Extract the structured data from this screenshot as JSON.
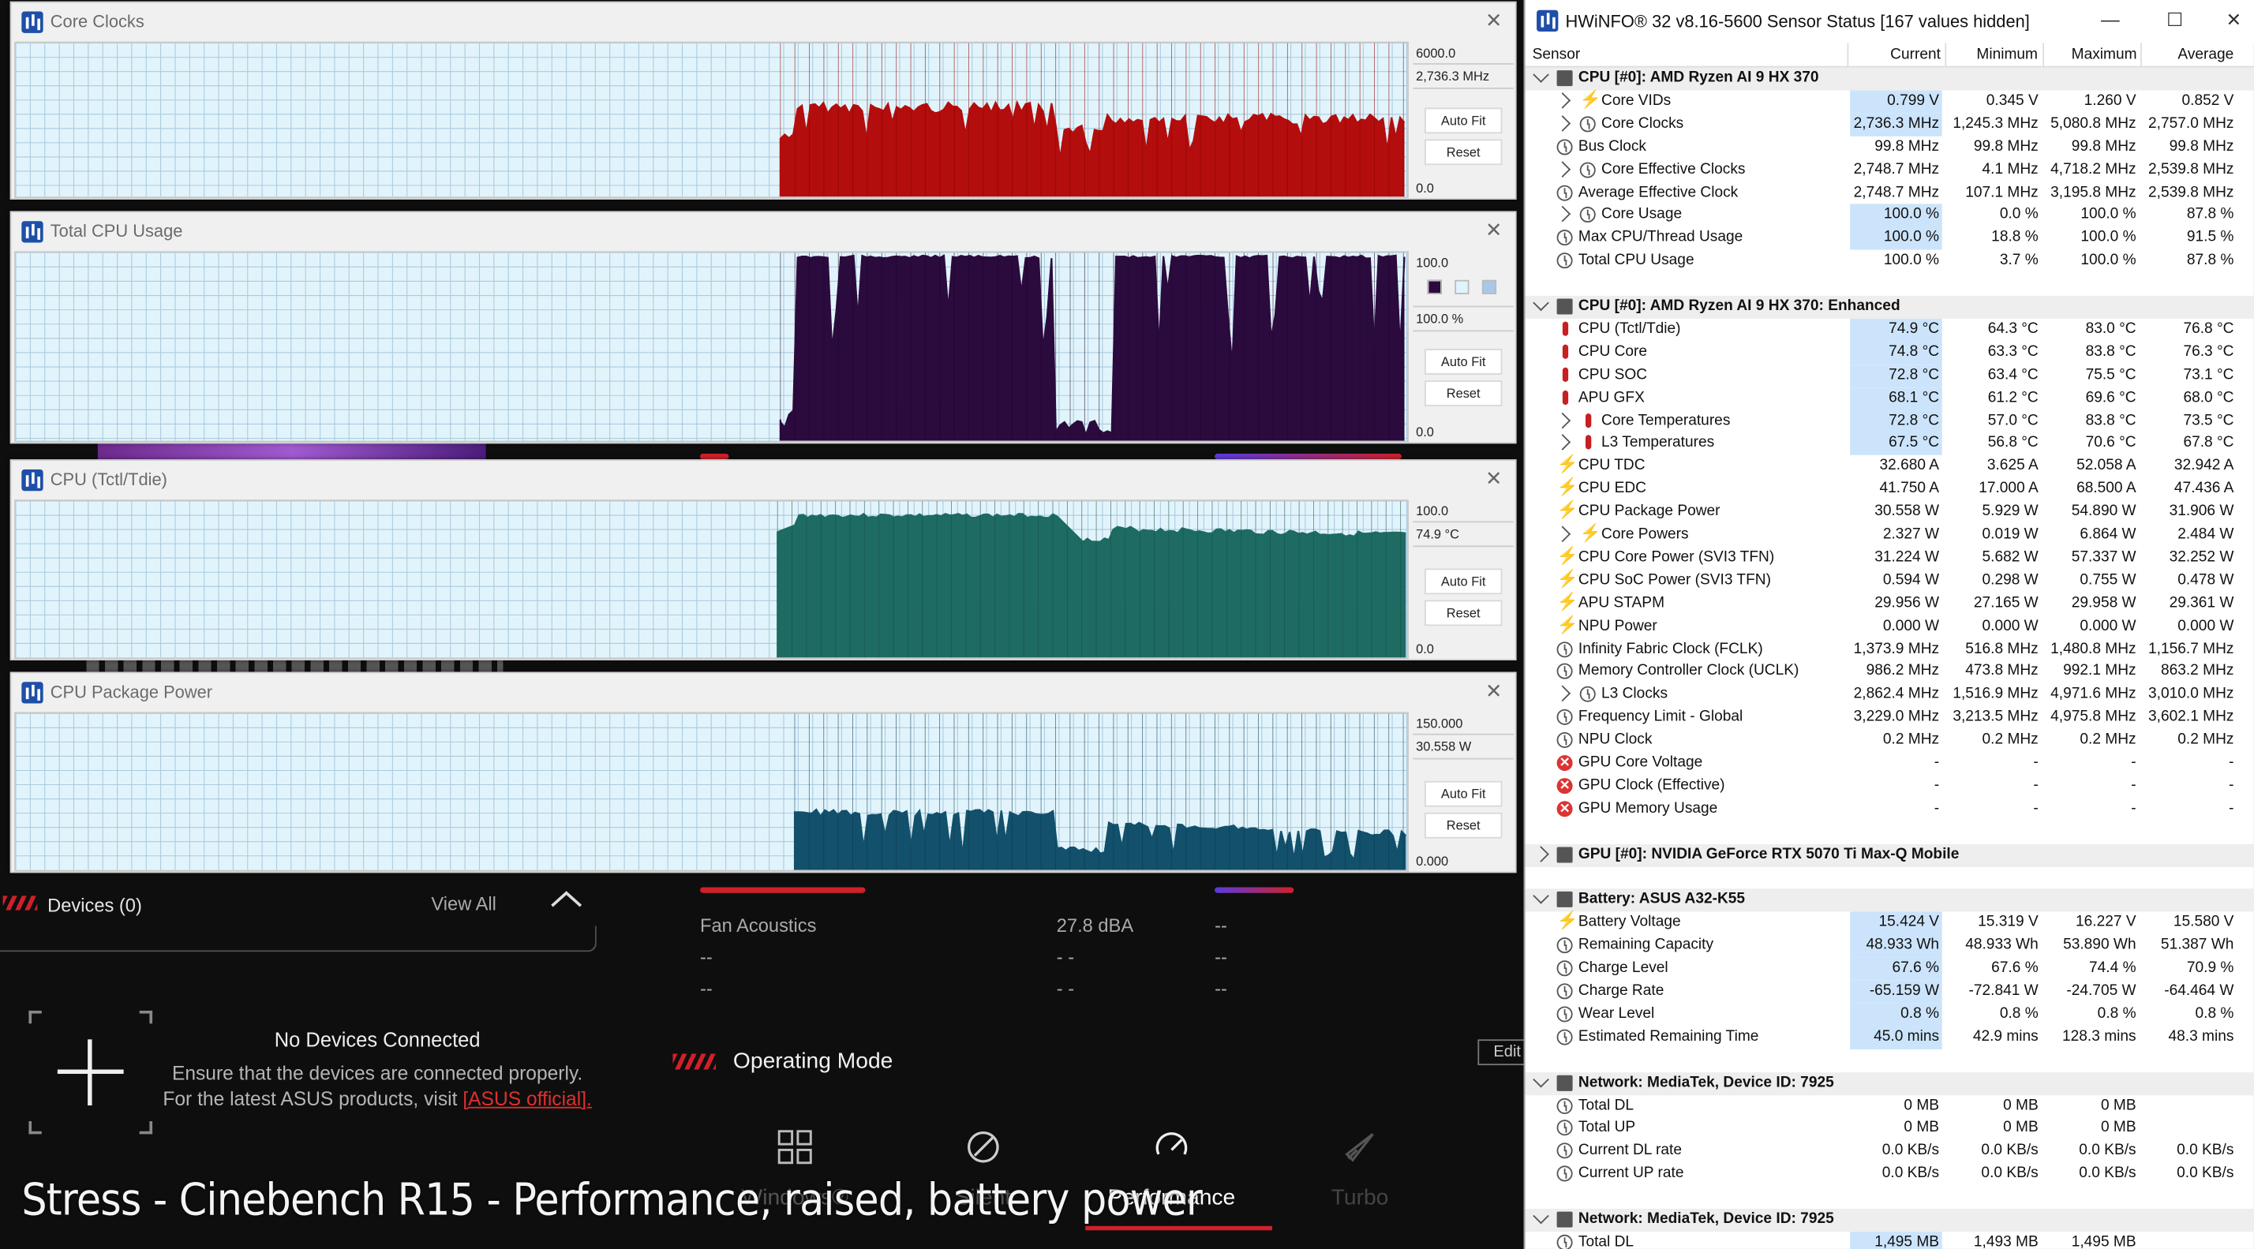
{
  "armoury": {
    "devices_title": "Devices (0)",
    "devices_view_all": "View All",
    "no_devices_title": "No Devices Connected",
    "no_devices_line1": "Ensure that the devices are connected properly.",
    "no_devices_line2": "For the latest ASUS products, visit",
    "no_devices_link": "[ASUS official].",
    "fan_rows": [
      {
        "label": "Fan Acoustics",
        "value": "27.8 dBA",
        "value2": "--"
      },
      {
        "label": "--",
        "value": "- -",
        "value2": "--"
      },
      {
        "label": "--",
        "value": "- -",
        "value2": "--"
      }
    ],
    "operating_mode_title": "Operating Mode",
    "edit_label": "Edit",
    "modes": [
      "Windows®",
      "Silent",
      "Performance",
      "Turbo"
    ],
    "active_mode": "Performance",
    "caption": "Stress - Cinebench R15 - Performance, raised, battery power"
  },
  "graphs": [
    {
      "title": "Core Clocks",
      "max": "6000.0",
      "current": "2,736.3 MHz",
      "min": "0.0",
      "color": "#b30d0d",
      "fill_dark": "#8a0000"
    },
    {
      "title": "Total CPU Usage",
      "max": "100.0",
      "current": "100.0 %",
      "min": "0.0",
      "color": "#2b0a3d",
      "fill_dark": "#1f0630"
    },
    {
      "title": "CPU (Tctl/Tdie)",
      "max": "100.0",
      "current": "74.9 °C",
      "min": "0.0",
      "color": "#1d6b63",
      "fill_dark": "#144f49"
    },
    {
      "title": "CPU Package Power",
      "max": "150.000",
      "current": "30.558 W",
      "min": "0.000",
      "color": "#12506b",
      "fill_dark": "#0c3a4f"
    }
  ],
  "graph_buttons": {
    "auto_fit": "Auto Fit",
    "reset": "Reset"
  },
  "hwinfo": {
    "title": "HWiNFO® 32 v8.16-5600 Sensor Status [167 values hidden]",
    "columns": [
      "Sensor",
      "Current",
      "Minimum",
      "Maximum",
      "Average"
    ],
    "rows": [
      {
        "t": "g",
        "name": "CPU [#0]: AMD Ryzen AI 9 HX 370",
        "exp": "down"
      },
      {
        "t": "s",
        "i": "bolt",
        "name": "Core VIDs",
        "c": "0.799 V",
        "mn": "0.345 V",
        "mx": "1.260 V",
        "av": "0.852 V",
        "exp": "right",
        "hl": true
      },
      {
        "t": "s",
        "i": "clock",
        "name": "Core Clocks",
        "c": "2,736.3 MHz",
        "mn": "1,245.3 MHz",
        "mx": "5,080.8 MHz",
        "av": "2,757.0 MHz",
        "exp": "right",
        "hl": true
      },
      {
        "t": "s",
        "i": "clock",
        "name": "Bus Clock",
        "c": "99.8 MHz",
        "mn": "99.8 MHz",
        "mx": "99.8 MHz",
        "av": "99.8 MHz"
      },
      {
        "t": "s",
        "i": "clock",
        "name": "Core Effective Clocks",
        "c": "2,748.7 MHz",
        "mn": "4.1 MHz",
        "mx": "4,718.2 MHz",
        "av": "2,539.8 MHz",
        "exp": "right"
      },
      {
        "t": "s",
        "i": "clock",
        "name": "Average Effective Clock",
        "c": "2,748.7 MHz",
        "mn": "107.1 MHz",
        "mx": "3,195.8 MHz",
        "av": "2,539.8 MHz"
      },
      {
        "t": "s",
        "i": "clock",
        "name": "Core Usage",
        "c": "100.0 %",
        "mn": "0.0 %",
        "mx": "100.0 %",
        "av": "87.8 %",
        "exp": "right",
        "hl": true
      },
      {
        "t": "s",
        "i": "clock",
        "name": "Max CPU/Thread Usage",
        "c": "100.0 %",
        "mn": "18.8 %",
        "mx": "100.0 %",
        "av": "91.5 %",
        "hl": true
      },
      {
        "t": "s",
        "i": "clock",
        "name": "Total CPU Usage",
        "c": "100.0 %",
        "mn": "3.7 %",
        "mx": "100.0 %",
        "av": "87.8 %"
      },
      {
        "t": "blank"
      },
      {
        "t": "g",
        "name": "CPU [#0]: AMD Ryzen AI 9 HX 370: Enhanced",
        "exp": "down"
      },
      {
        "t": "s",
        "i": "therm",
        "name": "CPU (Tctl/Tdie)",
        "c": "74.9 °C",
        "mn": "64.3 °C",
        "mx": "83.0 °C",
        "av": "76.8 °C",
        "hl": true
      },
      {
        "t": "s",
        "i": "therm",
        "name": "CPU Core",
        "c": "74.8 °C",
        "mn": "63.3 °C",
        "mx": "83.8 °C",
        "av": "76.3 °C",
        "hl": true
      },
      {
        "t": "s",
        "i": "therm",
        "name": "CPU SOC",
        "c": "72.8 °C",
        "mn": "63.4 °C",
        "mx": "75.5 °C",
        "av": "73.1 °C",
        "hl": true
      },
      {
        "t": "s",
        "i": "therm",
        "name": "APU GFX",
        "c": "68.1 °C",
        "mn": "61.2 °C",
        "mx": "69.6 °C",
        "av": "68.0 °C",
        "hl": true
      },
      {
        "t": "s",
        "i": "therm",
        "name": "Core Temperatures",
        "c": "72.8 °C",
        "mn": "57.0 °C",
        "mx": "83.8 °C",
        "av": "73.5 °C",
        "exp": "right",
        "hl": true
      },
      {
        "t": "s",
        "i": "therm",
        "name": "L3 Temperatures",
        "c": "67.5 °C",
        "mn": "56.8 °C",
        "mx": "70.6 °C",
        "av": "67.8 °C",
        "exp": "right",
        "hl": true
      },
      {
        "t": "s",
        "i": "bolt",
        "name": "CPU TDC",
        "c": "32.680 A",
        "mn": "3.625 A",
        "mx": "52.058 A",
        "av": "32.942 A"
      },
      {
        "t": "s",
        "i": "bolt",
        "name": "CPU EDC",
        "c": "41.750 A",
        "mn": "17.000 A",
        "mx": "68.500 A",
        "av": "47.436 A"
      },
      {
        "t": "s",
        "i": "bolt",
        "name": "CPU Package Power",
        "c": "30.558 W",
        "mn": "5.929 W",
        "mx": "54.890 W",
        "av": "31.906 W"
      },
      {
        "t": "s",
        "i": "bolt",
        "name": "Core Powers",
        "c": "2.327 W",
        "mn": "0.019 W",
        "mx": "6.864 W",
        "av": "2.484 W",
        "exp": "right"
      },
      {
        "t": "s",
        "i": "bolt",
        "name": "CPU Core Power (SVI3 TFN)",
        "c": "31.224 W",
        "mn": "5.682 W",
        "mx": "57.337 W",
        "av": "32.252 W"
      },
      {
        "t": "s",
        "i": "bolt",
        "name": "CPU SoC Power (SVI3 TFN)",
        "c": "0.594 W",
        "mn": "0.298 W",
        "mx": "0.755 W",
        "av": "0.478 W"
      },
      {
        "t": "s",
        "i": "bolt",
        "name": "APU STAPM",
        "c": "29.956 W",
        "mn": "27.165 W",
        "mx": "29.958 W",
        "av": "29.361 W"
      },
      {
        "t": "s",
        "i": "bolt",
        "name": "NPU Power",
        "c": "0.000 W",
        "mn": "0.000 W",
        "mx": "0.000 W",
        "av": "0.000 W"
      },
      {
        "t": "s",
        "i": "clock",
        "name": "Infinity Fabric Clock (FCLK)",
        "c": "1,373.9 MHz",
        "mn": "516.8 MHz",
        "mx": "1,480.8 MHz",
        "av": "1,156.7 MHz"
      },
      {
        "t": "s",
        "i": "clock",
        "name": "Memory Controller Clock (UCLK)",
        "c": "986.2 MHz",
        "mn": "473.8 MHz",
        "mx": "992.1 MHz",
        "av": "863.2 MHz"
      },
      {
        "t": "s",
        "i": "clock",
        "name": "L3 Clocks",
        "c": "2,862.4 MHz",
        "mn": "1,516.9 MHz",
        "mx": "4,971.6 MHz",
        "av": "3,010.0 MHz",
        "exp": "right"
      },
      {
        "t": "s",
        "i": "clock",
        "name": "Frequency Limit - Global",
        "c": "3,229.0 MHz",
        "mn": "3,213.5 MHz",
        "mx": "4,975.8 MHz",
        "av": "3,602.1 MHz"
      },
      {
        "t": "s",
        "i": "clock",
        "name": "NPU Clock",
        "c": "0.2 MHz",
        "mn": "0.2 MHz",
        "mx": "0.2 MHz",
        "av": "0.2 MHz"
      },
      {
        "t": "s",
        "i": "err",
        "name": "GPU Core Voltage",
        "c": "-",
        "mn": "-",
        "mx": "-",
        "av": "-"
      },
      {
        "t": "s",
        "i": "err",
        "name": "GPU Clock (Effective)",
        "c": "-",
        "mn": "-",
        "mx": "-",
        "av": "-"
      },
      {
        "t": "s",
        "i": "err",
        "name": "GPU Memory Usage",
        "c": "-",
        "mn": "-",
        "mx": "-",
        "av": "-"
      },
      {
        "t": "blank"
      },
      {
        "t": "g",
        "name": "GPU [#0]: NVIDIA  GeForce RTX 5070 Ti Max-Q Mobile",
        "exp": "right"
      },
      {
        "t": "blank"
      },
      {
        "t": "g",
        "name": "Battery: ASUS  A32-K55",
        "exp": "down"
      },
      {
        "t": "s",
        "i": "bolt",
        "name": "Battery Voltage",
        "c": "15.424 V",
        "mn": "15.319 V",
        "mx": "16.227 V",
        "av": "15.580 V",
        "hl": true
      },
      {
        "t": "s",
        "i": "clock",
        "name": "Remaining Capacity",
        "c": "48.933 Wh",
        "mn": "48.933 Wh",
        "mx": "53.890 Wh",
        "av": "51.387 Wh",
        "hl": true
      },
      {
        "t": "s",
        "i": "clock",
        "name": "Charge Level",
        "c": "67.6 %",
        "mn": "67.6 %",
        "mx": "74.4 %",
        "av": "70.9 %",
        "hl": true
      },
      {
        "t": "s",
        "i": "clock",
        "name": "Charge Rate",
        "c": "-65.159 W",
        "mn": "-72.841 W",
        "mx": "-24.705 W",
        "av": "-64.464 W",
        "hl": true
      },
      {
        "t": "s",
        "i": "clock",
        "name": "Wear Level",
        "c": "0.8 %",
        "mn": "0.8 %",
        "mx": "0.8 %",
        "av": "0.8 %",
        "hl": true
      },
      {
        "t": "s",
        "i": "clock",
        "name": "Estimated Remaining Time",
        "c": "45.0 mins",
        "mn": "42.9 mins",
        "mx": "128.3 mins",
        "av": "48.3 mins",
        "hl": true
      },
      {
        "t": "blank"
      },
      {
        "t": "g",
        "name": "Network: MediaTek, Device ID: 7925",
        "exp": "down"
      },
      {
        "t": "s",
        "i": "clock",
        "name": "Total DL",
        "c": "0 MB",
        "mn": "0 MB",
        "mx": "0 MB",
        "av": ""
      },
      {
        "t": "s",
        "i": "clock",
        "name": "Total UP",
        "c": "0 MB",
        "mn": "0 MB",
        "mx": "0 MB",
        "av": ""
      },
      {
        "t": "s",
        "i": "clock",
        "name": "Current DL rate",
        "c": "0.0 KB/s",
        "mn": "0.0 KB/s",
        "mx": "0.0 KB/s",
        "av": "0.0 KB/s"
      },
      {
        "t": "s",
        "i": "clock",
        "name": "Current UP rate",
        "c": "0.0 KB/s",
        "mn": "0.0 KB/s",
        "mx": "0.0 KB/s",
        "av": "0.0 KB/s"
      },
      {
        "t": "blank"
      },
      {
        "t": "g",
        "name": "Network: MediaTek, Device ID: 7925",
        "exp": "down"
      },
      {
        "t": "s",
        "i": "clock",
        "name": "Total DL",
        "c": "1,495 MB",
        "mn": "1,493 MB",
        "mx": "1,495 MB",
        "av": "",
        "hl": true
      }
    ]
  }
}
